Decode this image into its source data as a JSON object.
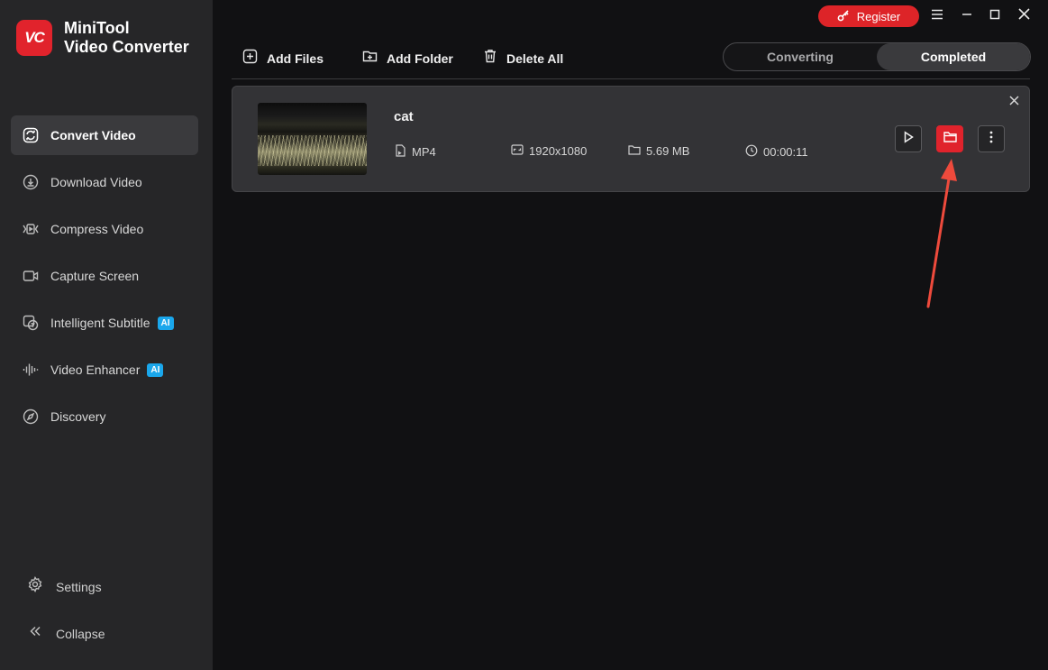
{
  "brand": {
    "line1": "MiniTool",
    "line2": "Video Converter",
    "logo_text": "VC"
  },
  "sidebar": {
    "items": [
      {
        "label": "Convert Video",
        "icon": "convert-icon",
        "active": true
      },
      {
        "label": "Download Video",
        "icon": "download-icon"
      },
      {
        "label": "Compress Video",
        "icon": "compress-icon"
      },
      {
        "label": "Capture Screen",
        "icon": "camera-icon"
      },
      {
        "label": "Intelligent Subtitle",
        "icon": "subtitle-icon",
        "badge": "AI"
      },
      {
        "label": "Video Enhancer",
        "icon": "waveform-icon",
        "badge": "AI"
      },
      {
        "label": "Discovery",
        "icon": "compass-icon"
      }
    ],
    "settings_label": "Settings",
    "collapse_label": "Collapse"
  },
  "topbar": {
    "register_label": "Register"
  },
  "toolbar": {
    "add_files": "Add Files",
    "add_folder": "Add Folder",
    "delete_all": "Delete All"
  },
  "tabs": {
    "converting": "Converting",
    "completed": "Completed",
    "active": "completed"
  },
  "file": {
    "name": "cat",
    "format": "MP4",
    "resolution": "1920x1080",
    "size": "5.69 MB",
    "duration": "00:00:11"
  },
  "colors": {
    "accent": "#e0232c",
    "badge": "#1aa7ec",
    "sidebar": "#262628",
    "background": "#111113",
    "card": "#333336"
  }
}
